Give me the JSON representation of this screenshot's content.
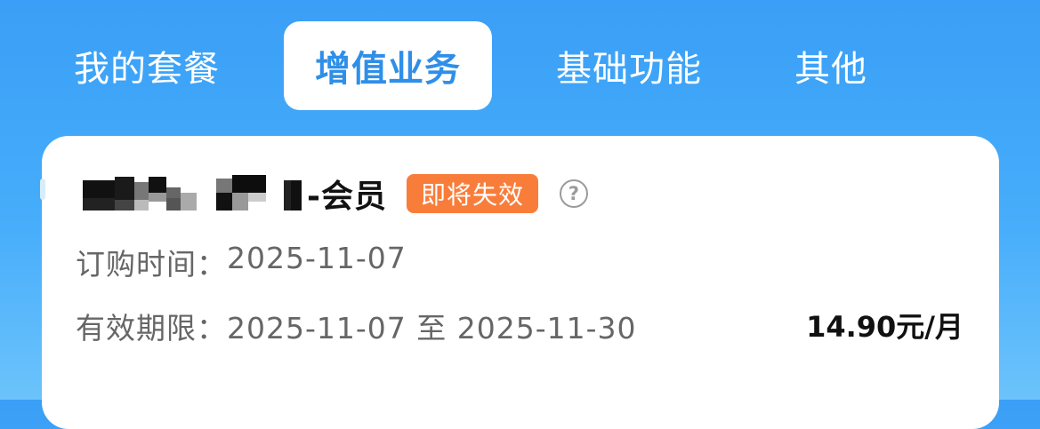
{
  "tabs": [
    {
      "label": "我的套餐",
      "active": false
    },
    {
      "label": "增值业务",
      "active": true
    },
    {
      "label": "基础功能",
      "active": false
    },
    {
      "label": "其他",
      "active": false
    }
  ],
  "card": {
    "title_suffix": "-会员",
    "badge": "即将失效",
    "help_icon": "question-circle-icon",
    "order_time_label": "订购时间：",
    "order_time_value": "2025-11-07",
    "validity_label": "有效期限：",
    "validity_value": "2025-11-07 至 2025-11-30",
    "price": "14.90元/月"
  },
  "colors": {
    "background_top": "#3a9ff6",
    "active_tab_text": "#2f8fe8",
    "badge": "#f97d3a"
  }
}
